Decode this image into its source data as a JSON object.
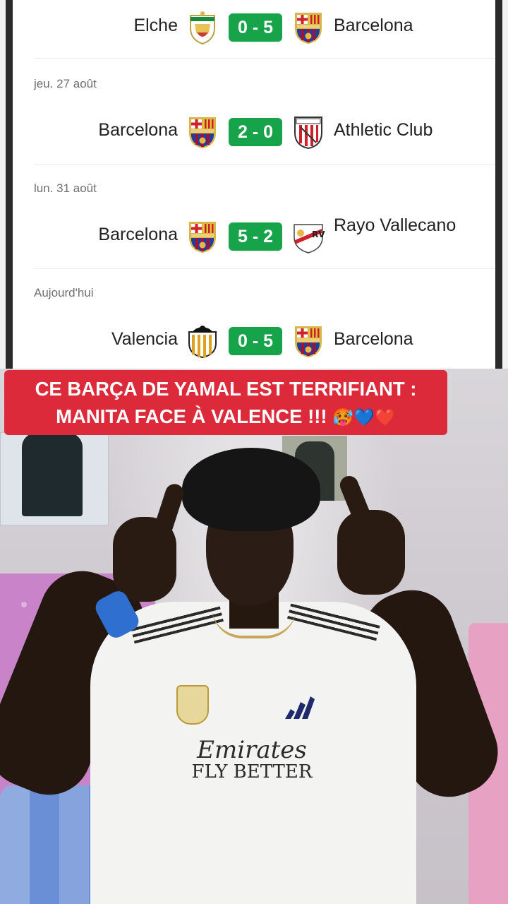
{
  "matches": [
    {
      "date": "",
      "home": "Elche",
      "home_crest": "elche-crest-icon",
      "score": "0 - 5",
      "away": "Barcelona",
      "away_crest": "barcelona-crest-icon"
    },
    {
      "date": "jeu. 27 août",
      "home": "Barcelona",
      "home_crest": "barcelona-crest-icon",
      "score": "2 - 0",
      "away": "Athletic Club",
      "away_crest": "athletic-club-crest-icon"
    },
    {
      "date": "lun. 31 août",
      "home": "Barcelona",
      "home_crest": "barcelona-crest-icon",
      "score": "5 - 2",
      "away": "Rayo Vallecano",
      "away_crest": "rayo-vallecano-crest-icon"
    },
    {
      "date": "Aujourd'hui",
      "home": "Valencia",
      "home_crest": "valencia-crest-icon",
      "score": "0 - 5",
      "away": "Barcelona",
      "away_crest": "barcelona-crest-icon"
    }
  ],
  "caption": {
    "line1": "CE BARÇA DE YAMAL EST TERRIFIANT :",
    "line2": "MANITA FACE À VALENCE !!!",
    "emojis": "🥵💙❤️"
  },
  "jersey": {
    "sponsor_line1": "Emirates",
    "sponsor_line2": "FLY BETTER"
  },
  "colors": {
    "score_bg": "#17a34a",
    "caption_bg": "#dd2a3a"
  }
}
